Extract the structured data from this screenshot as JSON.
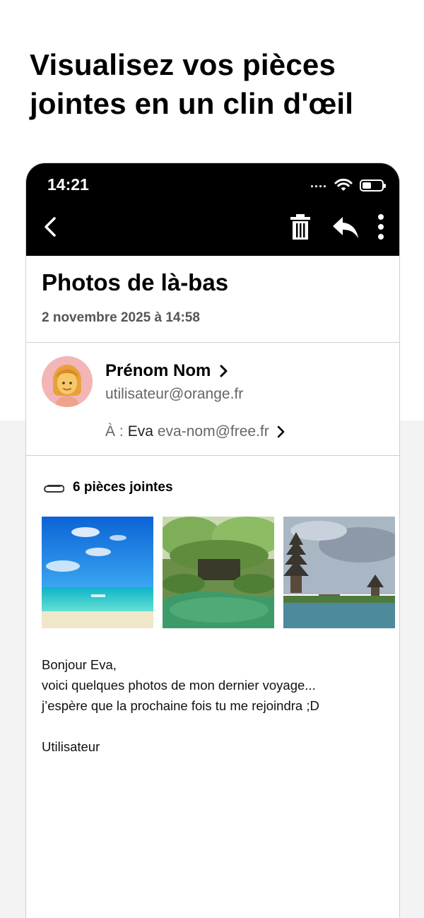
{
  "headline": "Visualisez vos pièces jointes en un clin d'œil",
  "status_bar": {
    "time": "14:21",
    "signal": "....",
    "icons": [
      "wifi-icon",
      "battery-icon"
    ]
  },
  "toolbar": {
    "icons": [
      "back-chevron-icon",
      "trash-icon",
      "reply-icon",
      "more-vertical-icon"
    ]
  },
  "email": {
    "subject": "Photos de là-bas",
    "date": "2 novembre 2025 à 14:58",
    "sender": {
      "name": "Prénom Nom",
      "email": "utilisateur@orange.fr",
      "avatar": "woman-emoji-avatar"
    },
    "recipient": {
      "prefix": "À :",
      "name": "Eva",
      "email": "eva-nom@free.fr"
    },
    "attachments": {
      "label": "6 pièces jointes",
      "icon": "paperclip-icon",
      "thumbnails": [
        "beach-photo",
        "garden-pond-photo",
        "temple-lake-photo"
      ]
    },
    "body_lines": [
      "Bonjour Eva,",
      "voici quelques photos de mon dernier voyage...",
      "j’espère que la prochaine fois tu me rejoindra ;D",
      "",
      "Utilisateur"
    ]
  },
  "colors": {
    "toolbar_bg": "#000000",
    "page_bg_lower": "#f3f3f3",
    "date_text": "#555555",
    "avatar_bg": "#f2b6b6"
  }
}
